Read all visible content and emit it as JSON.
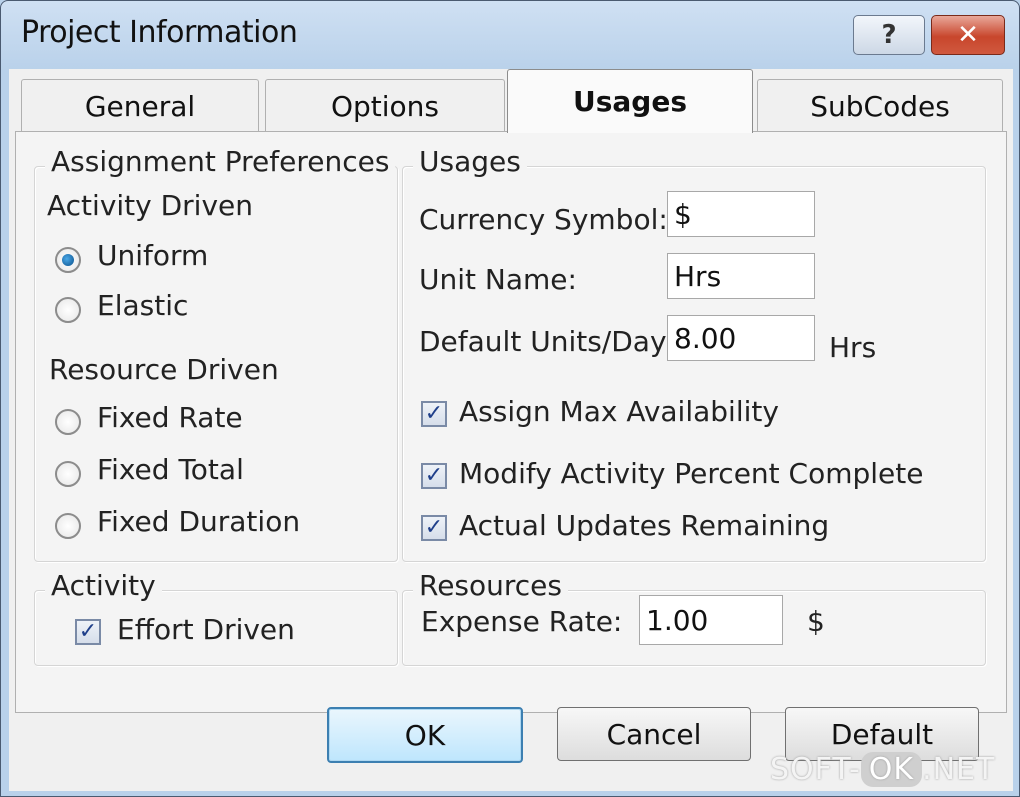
{
  "window": {
    "title": "Project Information",
    "help_symbol": "?",
    "close_symbol": "✕"
  },
  "tabs": [
    {
      "label": "General",
      "active": false
    },
    {
      "label": "Options",
      "active": false
    },
    {
      "label": "Usages",
      "active": true
    },
    {
      "label": "SubCodes",
      "active": false
    }
  ],
  "assignment": {
    "title": "Assignment Preferences",
    "activity_driven": {
      "heading": "Activity Driven",
      "options": [
        {
          "label": "Uniform",
          "checked": true
        },
        {
          "label": "Elastic",
          "checked": false
        }
      ]
    },
    "resource_driven": {
      "heading": "Resource Driven",
      "options": [
        {
          "label": "Fixed Rate",
          "checked": false
        },
        {
          "label": "Fixed Total",
          "checked": false
        },
        {
          "label": "Fixed Duration",
          "checked": false
        }
      ]
    }
  },
  "usages": {
    "title": "Usages",
    "currency_symbol_label": "Currency Symbol:",
    "currency_symbol_value": "$",
    "unit_name_label": "Unit Name:",
    "unit_name_value": "Hrs",
    "default_units_label": "Default Units/Day:",
    "default_units_value": "8.00",
    "default_units_unit": "Hrs",
    "checkboxes": [
      {
        "label": "Assign Max Availability",
        "checked": true
      },
      {
        "label": "Modify Activity Percent Complete",
        "checked": true
      },
      {
        "label": "Actual Updates Remaining",
        "checked": true
      }
    ]
  },
  "activity": {
    "title": "Activity",
    "effort_driven_label": "Effort Driven",
    "effort_driven_checked": true
  },
  "resources": {
    "title": "Resources",
    "expense_rate_label": "Expense Rate:",
    "expense_rate_value": "1.00",
    "expense_rate_unit": "$"
  },
  "buttons": {
    "ok": "OK",
    "cancel": "Cancel",
    "default": "Default"
  },
  "check_glyph": "✓",
  "watermark": {
    "part1": "SOFT-",
    "part2": "OK",
    "part3": ".NET"
  }
}
